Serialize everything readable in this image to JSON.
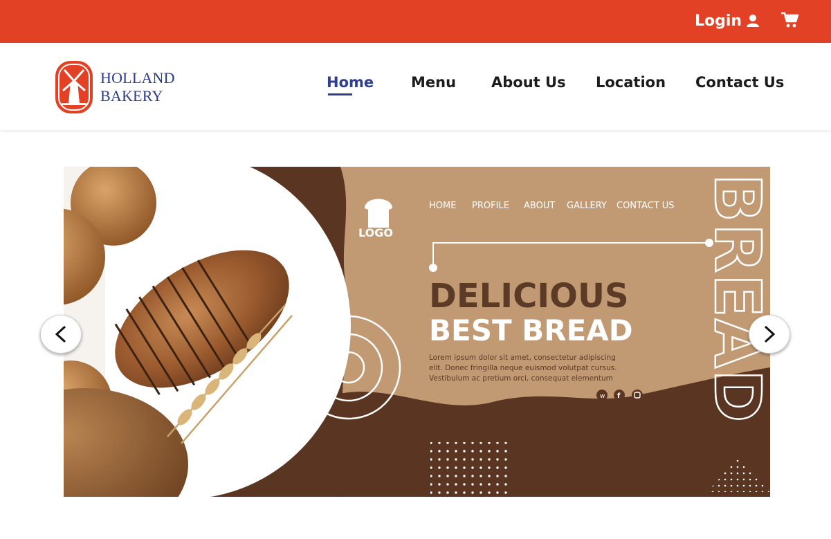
{
  "topbar": {
    "login_label": "Login",
    "login_icon": "user-icon",
    "cart_icon": "shopping-cart-icon",
    "color": "#e34126"
  },
  "brand": {
    "line1": "HOLLAND",
    "line2": "BAKERY",
    "badge_icon": "windmill-logo",
    "color": "#2a3a8c"
  },
  "nav": {
    "items": [
      {
        "label": "Home",
        "active": true
      },
      {
        "label": "Menu"
      },
      {
        "label": "About Us"
      },
      {
        "label": "Location"
      },
      {
        "label": "Contact Us"
      }
    ],
    "active_color": "#2f3f91"
  },
  "carousel": {
    "prev_icon": "chevron-left-icon",
    "next_icon": "chevron-right-icon",
    "slide": {
      "logo_text": "LOGO",
      "menu": [
        "HOME",
        "PROFILE",
        "ABOUT",
        "GALLERY",
        "CONTACT US"
      ],
      "headline_1": "DELICIOUS",
      "headline_2": "BEST BREAD",
      "body_1": "Lorem ipsum dolor sit amet, consectetur adipiscing",
      "body_2": "elit. Donec fringilla neque euismod volutpat cursus.",
      "body_3": "Vestibulum ac pretium orci, consequat elementum",
      "vertical_word": "BREAD",
      "social_icons": [
        "whatsapp-icon",
        "facebook-icon",
        "instagram-icon"
      ],
      "colors": {
        "tan": "#c19a73",
        "dark_brown": "#5a3522",
        "headline_dark": "#5b3a26"
      }
    }
  }
}
